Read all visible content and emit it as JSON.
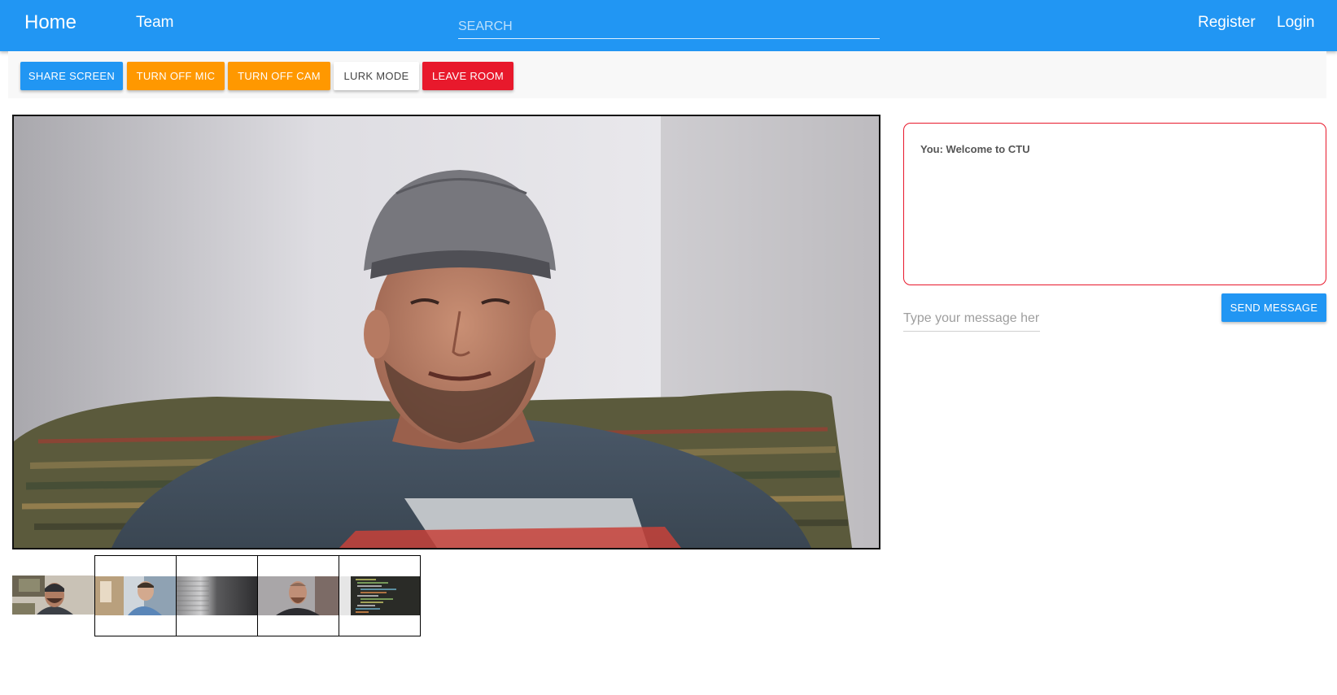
{
  "nav": {
    "home": "Home",
    "team": "Team",
    "search_placeholder": "SEARCH",
    "register": "Register",
    "login": "Login"
  },
  "toolbar": {
    "share_screen": "SHARE SCREEN",
    "turn_off_mic": "TURN OFF MIC",
    "turn_off_cam": "TURN OFF CAM",
    "lurk_mode": "LURK MODE",
    "leave_room": "LEAVE ROOM"
  },
  "chat": {
    "messages": [
      "You: Welcome to CTU"
    ],
    "input_placeholder": "Type your message here",
    "send_label": "SEND MESSAGE"
  },
  "colors": {
    "primary": "#2196f3",
    "warning": "#ff9800",
    "danger": "#e8192c"
  }
}
